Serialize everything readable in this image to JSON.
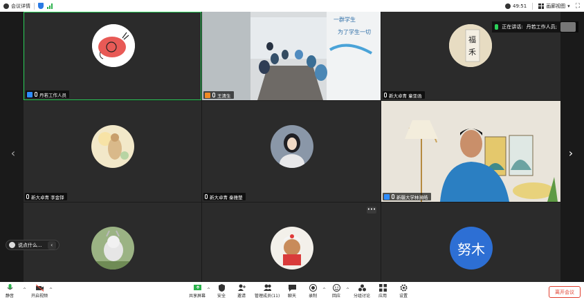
{
  "topbar": {
    "info_label": "会议详情",
    "timer": "49:51",
    "view_label": "画廊视图"
  },
  "speaking": {
    "prefix": "正在讲话:",
    "name": "丹若工作人员;"
  },
  "tiles": [
    {
      "name": "丹若工作人员"
    },
    {
      "name": "王清生"
    },
    {
      "name": "新大卓青 童亚函"
    },
    {
      "name": "新大卓青 李金铎"
    },
    {
      "name": "新大卓青 秦雅楚"
    },
    {
      "name": "新疆大学林濒皓"
    },
    {
      "name": ""
    },
    {
      "name": ""
    },
    {
      "name": "",
      "initials": "努木"
    }
  ],
  "chat_preview": "说点什么...",
  "more_button": "•••",
  "toolbar": {
    "mute": "静音",
    "video": "开启视频",
    "share": "共享屏幕",
    "security": "安全",
    "invite": "邀请",
    "participants": "管理成员(11)",
    "chat": "聊天",
    "record": "录制",
    "reactions": "回应",
    "breakout": "分组讨论",
    "apps": "应用",
    "settings": "设置",
    "leave": "离开会议"
  },
  "colors": {
    "active_border": "#2bd15a",
    "leave_red": "#e03e2d",
    "initials_bg": "#2d6fd4"
  }
}
